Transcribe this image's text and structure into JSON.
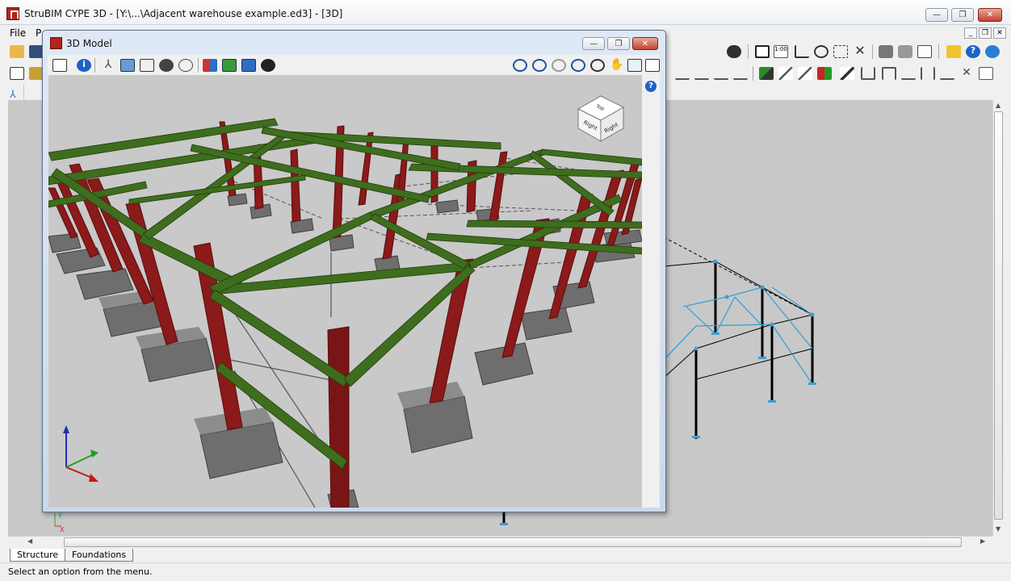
{
  "app": {
    "title": "StruBIM CYPE 3D - [Y:\\...\\Adjacent warehouse example.ed3] - [3D]",
    "icon": "strubim-logo-icon",
    "minimize_glyph": "—",
    "restore_glyph": "❐",
    "close_glyph": "✕"
  },
  "menu": {
    "items": [
      {
        "label": "File",
        "name": "menu-file"
      },
      {
        "label": "P",
        "name": "menu-p"
      }
    ]
  },
  "inner_window": {
    "title": "3D Model",
    "help_glyph": "?"
  },
  "tabs": [
    {
      "label": "Structure",
      "name": "tab-structure",
      "active": true
    },
    {
      "label": "Foundations",
      "name": "tab-foundations",
      "active": false
    }
  ],
  "status": {
    "text": "Select an option from the menu."
  },
  "view_cube": {
    "face_label": "Right",
    "top_label": "Top"
  },
  "axes": {
    "y_label": "Y",
    "x_label": "X"
  },
  "colors": {
    "column": "#8b1a1a",
    "beam": "#3f6d1e",
    "footing": "#6e6e6e",
    "viewport_bg": "#c9c9c9",
    "bracing_2d": "#3aa0d8"
  }
}
